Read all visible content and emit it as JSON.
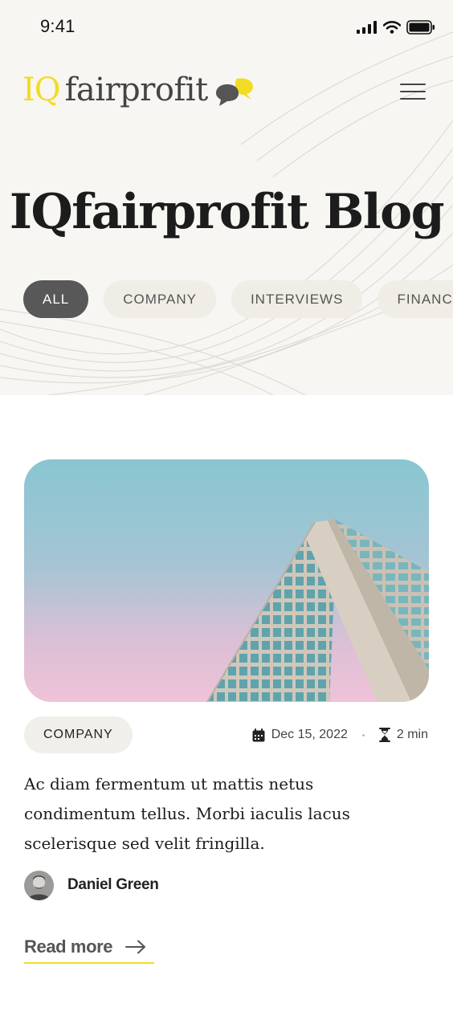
{
  "status_bar": {
    "time": "9:41",
    "icons": [
      "signal-icon",
      "wifi-icon",
      "battery-icon"
    ]
  },
  "header": {
    "logo_iq": "IQ",
    "logo_word": "fairprofit",
    "menu_icon": "hamburger-menu-icon"
  },
  "hero": {
    "title": "IQfairprofit Blog"
  },
  "filters": [
    {
      "label": "ALL",
      "active": true
    },
    {
      "label": "COMPANY",
      "active": false
    },
    {
      "label": "INTERVIEWS",
      "active": false
    },
    {
      "label": "FINANCE",
      "active": false
    }
  ],
  "post": {
    "image_icon": "building-photo",
    "category": "COMPANY",
    "date": "Dec 15, 2022",
    "read_time": "2 min",
    "excerpt": "Ac diam fermentum ut mattis netus condimentum tellus. Morbi iaculis lacus scelerisque sed velit fringilla.",
    "author": "Daniel Green",
    "read_more": "Read more"
  },
  "colors": {
    "brand_yellow": "#f2dc23",
    "hero_bg": "#f7f6f2",
    "chip_active": "#585858",
    "chip_bg": "#efede6",
    "text_dark": "#1d1d1d"
  }
}
